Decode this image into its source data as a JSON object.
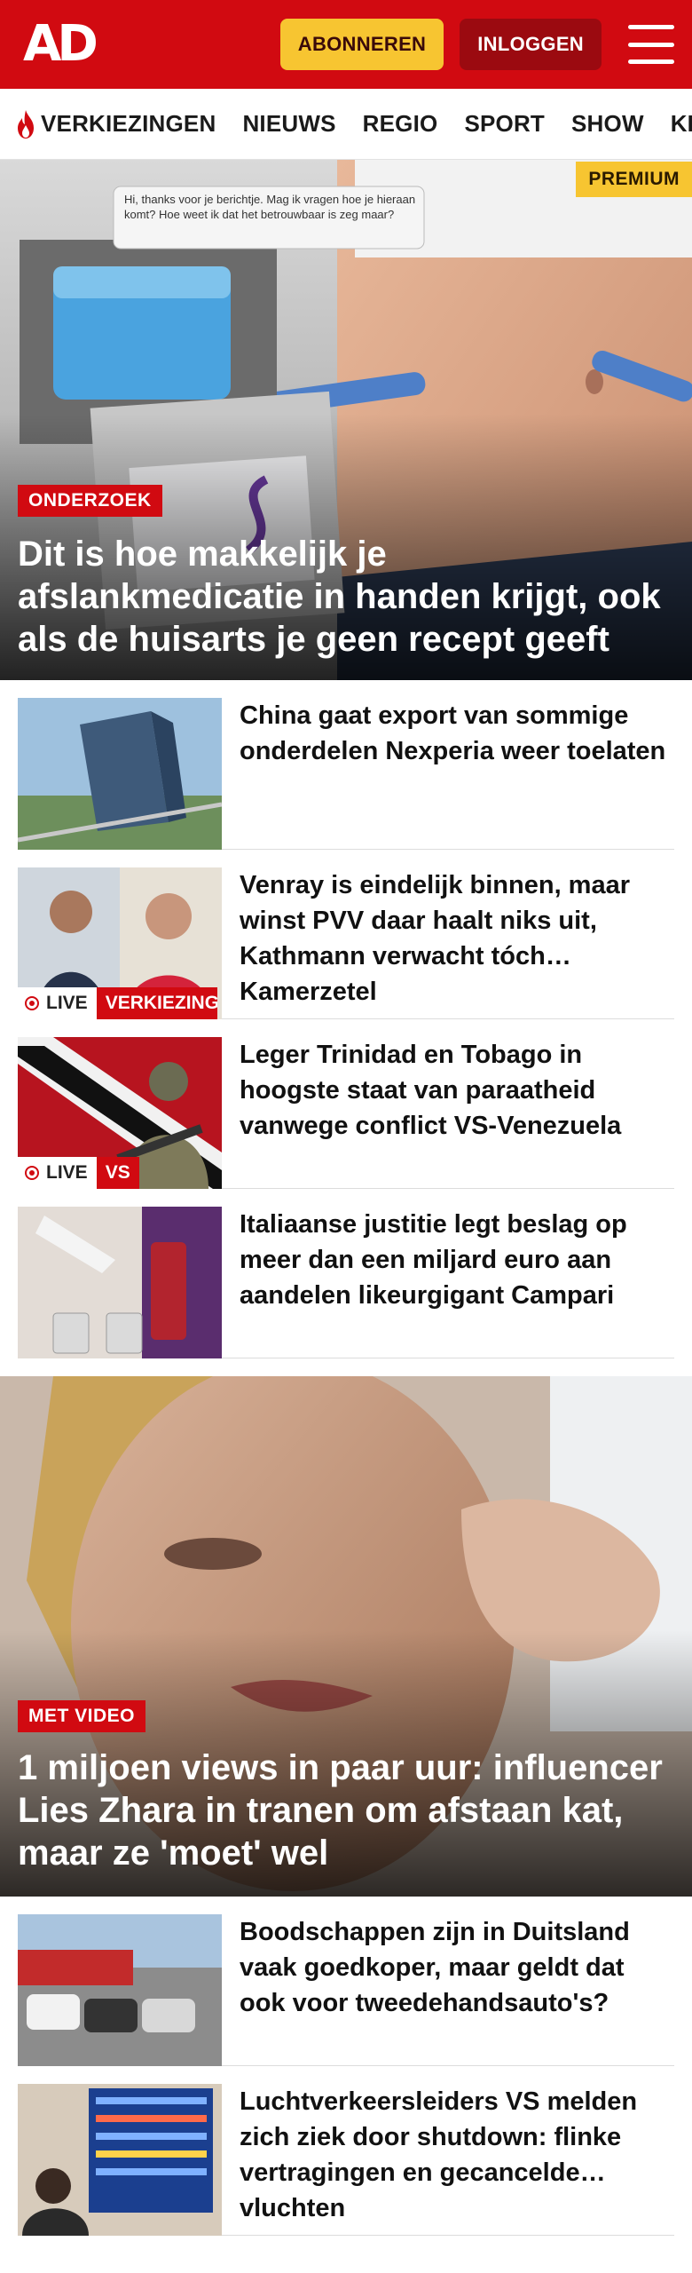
{
  "header": {
    "logo": "AD",
    "subscribe_label": "ABONNEREN",
    "login_label": "INLOGGEN",
    "brand_color": "#d10a11"
  },
  "nav": {
    "items": [
      "VERKIEZINGEN",
      "NIEUWS",
      "REGIO",
      "SPORT",
      "SHOW",
      "KIJK"
    ]
  },
  "hero": {
    "badge": "PREMIUM",
    "label": "ONDERZOEK",
    "title": "Dit is hoe makkelijk je afslankmedicatie in handen krijgt, ook als de huisarts je geen recept geeft",
    "chat_text": "Hi, thanks voor je berichtje. Mag ik vragen hoe je hieraan komt? Hoe weet ik dat het betrouwbaar is zeg maar?"
  },
  "articles": [
    {
      "title": "China gaat export van sommige onderdelen Nexperia weer toelaten"
    },
    {
      "title": "Venray is eindelijk binnen, maar winst PVV daar haalt niks uit, Kathmann verwacht tóch Kamerzetel",
      "live": "LIVE",
      "category": "VERKIEZINGEN"
    },
    {
      "title": "Leger Trinidad en Tobago in hoogste staat van paraatheid vanwege conflict VS-Venezuela",
      "live": "LIVE",
      "category": "VS"
    },
    {
      "title": "Italiaanse justitie legt beslag op meer dan een miljard euro aan aandelen likeurgigant Campari"
    }
  ],
  "hero2": {
    "label": "MET VIDEO",
    "title": "1 miljoen views in paar uur: influencer Lies Zhara in tranen om afstaan kat, maar ze 'moet' wel"
  },
  "articles2": [
    {
      "title": "Boodschappen zijn in Duitsland vaak goedkoper, maar geldt dat ook voor tweedehandsauto's?"
    },
    {
      "title": "Luchtverkeersleiders VS melden zich ziek door shutdown: flinke vertragingen en gecancelde vluchten"
    }
  ]
}
